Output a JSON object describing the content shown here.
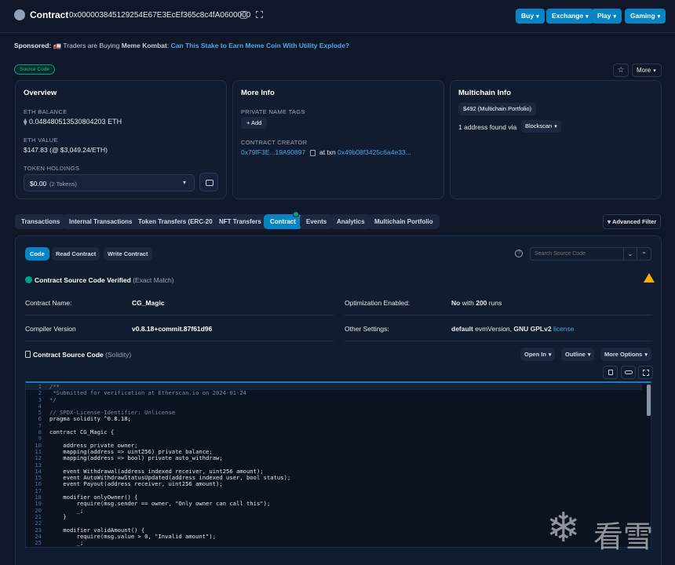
{
  "header": {
    "title": "Contract",
    "address": "0x000003845129254E67E3EcEf365c8c4fA0600000",
    "buttons": [
      "Buy",
      "Exchange",
      "Play",
      "Gaming"
    ]
  },
  "sponsored": {
    "label": "Sponsored:",
    "text": "🚛 Traders are Buying ",
    "bold": "Meme Kombat",
    "text2": ": ",
    "link": "Can This Stake to Earn Meme Coin With Utility Explode?"
  },
  "badge": "Source Code",
  "more_label": "More",
  "overview": {
    "title": "Overview",
    "eth_balance_label": "ETH BALANCE",
    "eth_balance": "0.048480513530804203 ETH",
    "eth_value_label": "ETH VALUE",
    "eth_value": "$147.83",
    "eth_value_sub": "(@ $3,049.24/ETH)",
    "token_label": "TOKEN HOLDINGS",
    "token_value": "$0.00",
    "token_sub": "(2 Tokens)"
  },
  "more_info": {
    "title": "More Info",
    "tags_label": "PRIVATE NAME TAGS",
    "add_label": "+ Add",
    "creator_label": "CONTRACT CREATOR",
    "creator": "0x79fF3E...19A90897",
    "at_txn": "at txn",
    "txn": "0x49b08f3425c6a4e33..."
  },
  "multichain": {
    "title": "Multichain Info",
    "portfolio": "$492 (Multichain Portfolio)",
    "found": "1 address found via",
    "blockscan": "Blockscan"
  },
  "tabs": [
    "Transactions",
    "Internal Transactions",
    "Token Transfers (ERC-20)",
    "NFT Transfers",
    "Contract",
    "Events",
    "Analytics",
    "Multichain Portfolio"
  ],
  "advanced_filter": "Advanced Filter",
  "subtabs": [
    "Code",
    "Read Contract",
    "Write Contract"
  ],
  "search_placeholder": "Search Source Code",
  "verified": {
    "text": "Contract Source Code Verified",
    "sub": "(Exact Match)"
  },
  "info_rows": {
    "name_label": "Contract Name:",
    "name": "CG_Magic",
    "opt_label": "Optimization Enabled:",
    "opt_value": "No",
    "opt_with": "with",
    "opt_runs": "200",
    "opt_runs_label": "runs",
    "compiler_label": "Compiler Version",
    "compiler": "v0.8.18+commit.87f61d96",
    "settings_label": "Other Settings:",
    "settings_default": "default",
    "settings_evm": "evmVersion,",
    "settings_license": "GNU GPLv2",
    "settings_link": "license"
  },
  "source": {
    "title": "Contract Source Code",
    "sub": "(Solidity)",
    "open_in": "Open In",
    "outline": "Outline",
    "more_options": "More Options"
  },
  "code_lines": [
    "/**",
    " *Submitted for verification at Etherscan.io on 2024-01-24",
    "*/",
    "",
    "// SPDX-License-Identifier: Unlicense",
    "pragma solidity ^0.8.18;",
    "",
    "contract CG_Magic {",
    "",
    "    address private owner;",
    "    mapping(address => uint256) private balance;",
    "    mapping(address => bool) private auto_withdraw;",
    "",
    "    event Withdrawal(address indexed receiver, uint256 amount);",
    "    event AutoWithdrawStatusUpdated(address indexed user, bool status);",
    "    event Payout(address receiver, uint256 amount);",
    "",
    "    modifier onlyOwner() {",
    "        require(msg.sender == owner, \"Only owner can call this\");",
    "        _;",
    "    }",
    "",
    "    modifier validAmount() {",
    "        require(msg.value > 0, \"Invalid amount\");",
    "        _;"
  ],
  "watermark": "看雪",
  "colors": {
    "accent": "#0784c3",
    "background": "#0f1729",
    "verified": "#00a186",
    "warning": "#f5b100"
  }
}
